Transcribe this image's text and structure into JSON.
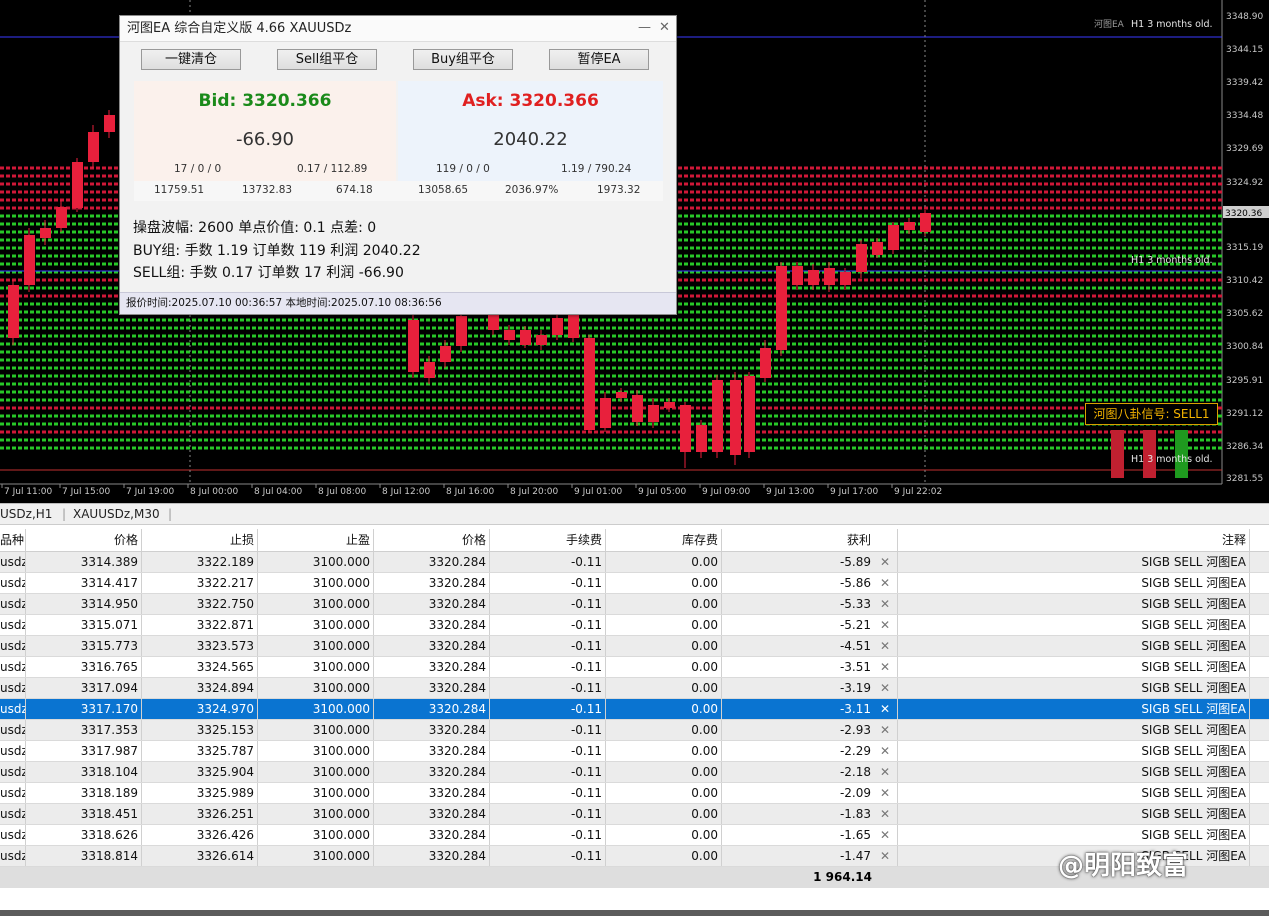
{
  "chart": {
    "price_ticks": [
      "3348.90",
      "3344.15",
      "3339.42",
      "3334.48",
      "3329.69",
      "3324.92",
      "3320.36",
      "3315.19",
      "3310.42",
      "3305.62",
      "3300.84",
      "3295.91",
      "3291.12",
      "3286.34",
      "3281.55"
    ],
    "current_price_label": "3320.36",
    "time_ticks": [
      "7 Jul 11:00",
      "7 Jul 15:00",
      "7 Jul 19:00",
      "8 Jul 00:00",
      "8 Jul 04:00",
      "8 Jul 08:00",
      "8 Jul 12:00",
      "8 Jul 16:00",
      "8 Jul 20:00",
      "9 Jul 01:00",
      "9 Jul 05:00",
      "9 Jul 09:00",
      "9 Jul 13:00",
      "9 Jul 17:00",
      "9 Jul 22:02"
    ],
    "top_right_label": "河图EA",
    "h1_top": "H1 3 months old.",
    "h1_mid": "H1 3 months old.",
    "h1_bot": "H1 3 months old.",
    "signal_label": "河图八卦信号: SELL1",
    "colors": {
      "bull": "#1ec81e",
      "bear": "#e8203c",
      "grid_red": "#d01838",
      "grid_green": "#28c828"
    }
  },
  "ea_panel": {
    "title": "河图EA 综合自定义版 4.66  XAUUSDz",
    "minimize_glyph": "—",
    "close_glyph": "✕",
    "buttons": {
      "close_all": "一键清仓",
      "sell_close": "Sell组平仓",
      "buy_close": "Buy组平仓",
      "pause": "暂停EA"
    },
    "bid": {
      "label": "Bid: 3320.366",
      "profit": "-66.90",
      "orders": "17 / 0 / 0",
      "lots": "0.17 / 112.89",
      "color": "#1a8a1a"
    },
    "ask": {
      "label": "Ask: 3320.366",
      "profit": "2040.22",
      "orders": "119 / 0 / 0",
      "lots": "1.19 / 790.24",
      "color": "#e02020"
    },
    "stats": [
      "11759.51",
      "13732.83",
      "674.18",
      "13058.65",
      "2036.97%",
      "1973.32"
    ],
    "info": [
      "操盘波幅: 2600 单点价值: 0.1 点差: 0",
      "BUY组: 手数 1.19 订单数 119 利润 2040.22",
      "SELL组: 手数 0.17 订单数 17 利润 -66.90"
    ],
    "footer": "报价时间:2025.07.10 00:36:57  本地时间:2025.07.10 08:36:56"
  },
  "tabs": [
    "USDz,H1",
    "XAUUSDz,M30"
  ],
  "table": {
    "headers": [
      "品种",
      "价格",
      "止损",
      "止盈",
      "价格",
      "手续费",
      "库存费",
      "获利",
      "注释"
    ],
    "rows": [
      [
        "usdz",
        "3314.389",
        "3322.189",
        "3100.000",
        "3320.284",
        "-0.11",
        "0.00",
        "-5.89",
        "SIGB SELL 河图EA"
      ],
      [
        "usdz",
        "3314.417",
        "3322.217",
        "3100.000",
        "3320.284",
        "-0.11",
        "0.00",
        "-5.86",
        "SIGB SELL 河图EA"
      ],
      [
        "usdz",
        "3314.950",
        "3322.750",
        "3100.000",
        "3320.284",
        "-0.11",
        "0.00",
        "-5.33",
        "SIGB SELL 河图EA"
      ],
      [
        "usdz",
        "3315.071",
        "3322.871",
        "3100.000",
        "3320.284",
        "-0.11",
        "0.00",
        "-5.21",
        "SIGB SELL 河图EA"
      ],
      [
        "usdz",
        "3315.773",
        "3323.573",
        "3100.000",
        "3320.284",
        "-0.11",
        "0.00",
        "-4.51",
        "SIGB SELL 河图EA"
      ],
      [
        "usdz",
        "3316.765",
        "3324.565",
        "3100.000",
        "3320.284",
        "-0.11",
        "0.00",
        "-3.51",
        "SIGB SELL 河图EA"
      ],
      [
        "usdz",
        "3317.094",
        "3324.894",
        "3100.000",
        "3320.284",
        "-0.11",
        "0.00",
        "-3.19",
        "SIGB SELL 河图EA"
      ],
      [
        "usdz",
        "3317.170",
        "3324.970",
        "3100.000",
        "3320.284",
        "-0.11",
        "0.00",
        "-3.11",
        "SIGB SELL 河图EA"
      ],
      [
        "usdz",
        "3317.353",
        "3325.153",
        "3100.000",
        "3320.284",
        "-0.11",
        "0.00",
        "-2.93",
        "SIGB SELL 河图EA"
      ],
      [
        "usdz",
        "3317.987",
        "3325.787",
        "3100.000",
        "3320.284",
        "-0.11",
        "0.00",
        "-2.29",
        "SIGB SELL 河图EA"
      ],
      [
        "usdz",
        "3318.104",
        "3325.904",
        "3100.000",
        "3320.284",
        "-0.11",
        "0.00",
        "-2.18",
        "SIGB SELL 河图EA"
      ],
      [
        "usdz",
        "3318.189",
        "3325.989",
        "3100.000",
        "3320.284",
        "-0.11",
        "0.00",
        "-2.09",
        "SIGB SELL 河图EA"
      ],
      [
        "usdz",
        "3318.451",
        "3326.251",
        "3100.000",
        "3320.284",
        "-0.11",
        "0.00",
        "-1.83",
        "SIGB SELL 河图EA"
      ],
      [
        "usdz",
        "3318.626",
        "3326.426",
        "3100.000",
        "3320.284",
        "-0.11",
        "0.00",
        "-1.65",
        "SIGB SELL 河图EA"
      ],
      [
        "usdz",
        "3318.814",
        "3326.614",
        "3100.000",
        "3320.284",
        "-0.11",
        "0.00",
        "-1.47",
        "SIGB SELL 河图EA"
      ]
    ],
    "selected_row": 7,
    "total": "1 964.14",
    "close_glyph": "✕"
  },
  "watermark": "@明阳致富"
}
